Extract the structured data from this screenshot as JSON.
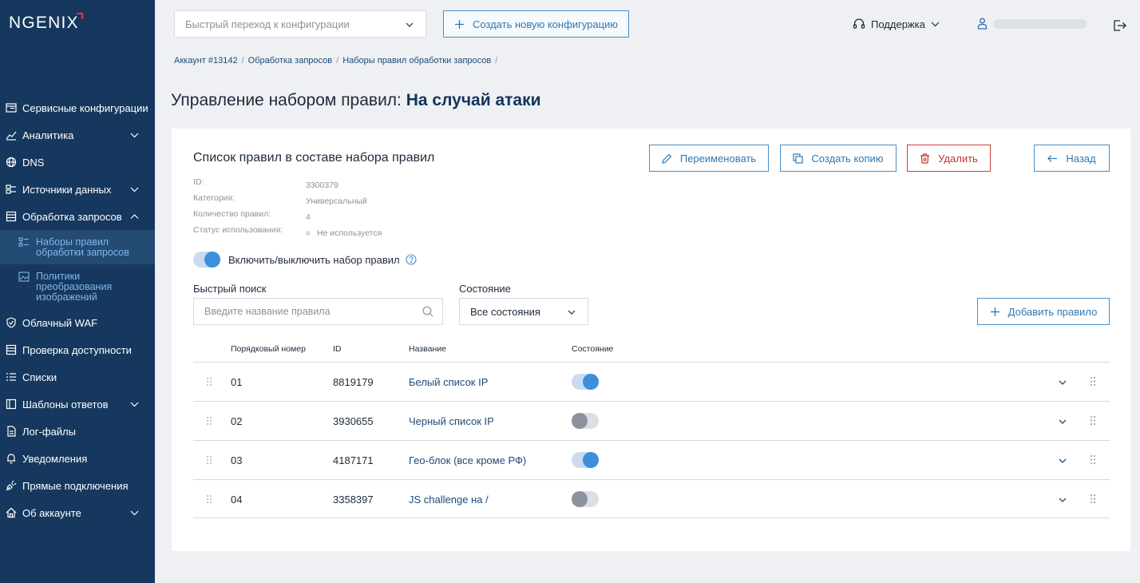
{
  "brand": {
    "logo": "NGENIX",
    "accent": "#e8334a",
    "sidebar_bg": "#16385e",
    "link": "#1d4a78"
  },
  "sidebar": {
    "items": [
      {
        "label": "Сервисные конфигурации",
        "icon": "server-config-icon"
      },
      {
        "label": "Аналитика",
        "icon": "chart-icon",
        "expandable": true
      },
      {
        "label": "DNS",
        "icon": "globe-icon"
      },
      {
        "label": "Источники данных",
        "icon": "data-sources-icon",
        "expandable": true
      },
      {
        "label": "Обработка запросов",
        "icon": "requests-icon",
        "expandable": true,
        "expanded": true
      },
      {
        "label": "Облачный WAF",
        "icon": "shield-icon"
      },
      {
        "label": "Проверка доступности",
        "icon": "availability-icon"
      },
      {
        "label": "Списки",
        "icon": "list-icon"
      },
      {
        "label": "Шаблоны ответов",
        "icon": "templates-icon",
        "expandable": true
      },
      {
        "label": "Лог-файлы",
        "icon": "log-files-icon"
      },
      {
        "label": "Уведомления",
        "icon": "bell-icon"
      },
      {
        "label": "Прямые подключения",
        "icon": "plug-icon"
      },
      {
        "label": "Об аккаунте",
        "icon": "home-icon",
        "expandable": true
      }
    ],
    "subitems": [
      {
        "label_1": "Наборы правил",
        "label_2": "обработки запросов",
        "active": true,
        "icon": "rules-icon"
      },
      {
        "label_1": "Политики",
        "label_2": "преобразования",
        "label_3": "изображений",
        "icon": "image-icon"
      }
    ]
  },
  "topbar": {
    "quick_nav_placeholder": "Быстрый переход к конфигурации",
    "create_config": "Создать новую конфигурацию",
    "support": "Поддержка"
  },
  "breadcrumb": [
    "Аккаунт #13142",
    "Обработка запросов",
    "Наборы правил обработки запросов"
  ],
  "page": {
    "title_prefix": "Управление набором правил: ",
    "title_name": "На случай атаки"
  },
  "card": {
    "title": "Список правил в составе набора правил",
    "meta": [
      {
        "key": "ID:",
        "value": "3300379"
      },
      {
        "key": "Категория:",
        "value": "Универсальный"
      },
      {
        "key": "Количество правил:",
        "value": "4"
      },
      {
        "key": "Статус использования:",
        "value": "Не используется"
      }
    ],
    "buttons": {
      "rename": "Переименовать",
      "copy": "Создать копию",
      "delete": "Удалить",
      "back": "Назад",
      "add_rule": "Добавить правило"
    },
    "toggle_label": "Включить/выключить набор правил",
    "toggle_on": true,
    "search_label": "Быстрый поиск",
    "search_placeholder": "Введите название правила",
    "state_label": "Состояние",
    "state_value": "Все состояния",
    "columns": {
      "order": "Порядковый номер",
      "id": "ID",
      "name": "Название",
      "state": "Состояние"
    },
    "rows": [
      {
        "order": "01",
        "id": "8819179",
        "name": "Белый список IP",
        "enabled": true
      },
      {
        "order": "02",
        "id": "3930655",
        "name": "Черный список IP",
        "enabled": false
      },
      {
        "order": "03",
        "id": "4187171",
        "name": "Гео-блок (все кроме РФ)",
        "enabled": true
      },
      {
        "order": "04",
        "id": "3358397",
        "name": "JS challenge на /",
        "enabled": false
      }
    ]
  }
}
